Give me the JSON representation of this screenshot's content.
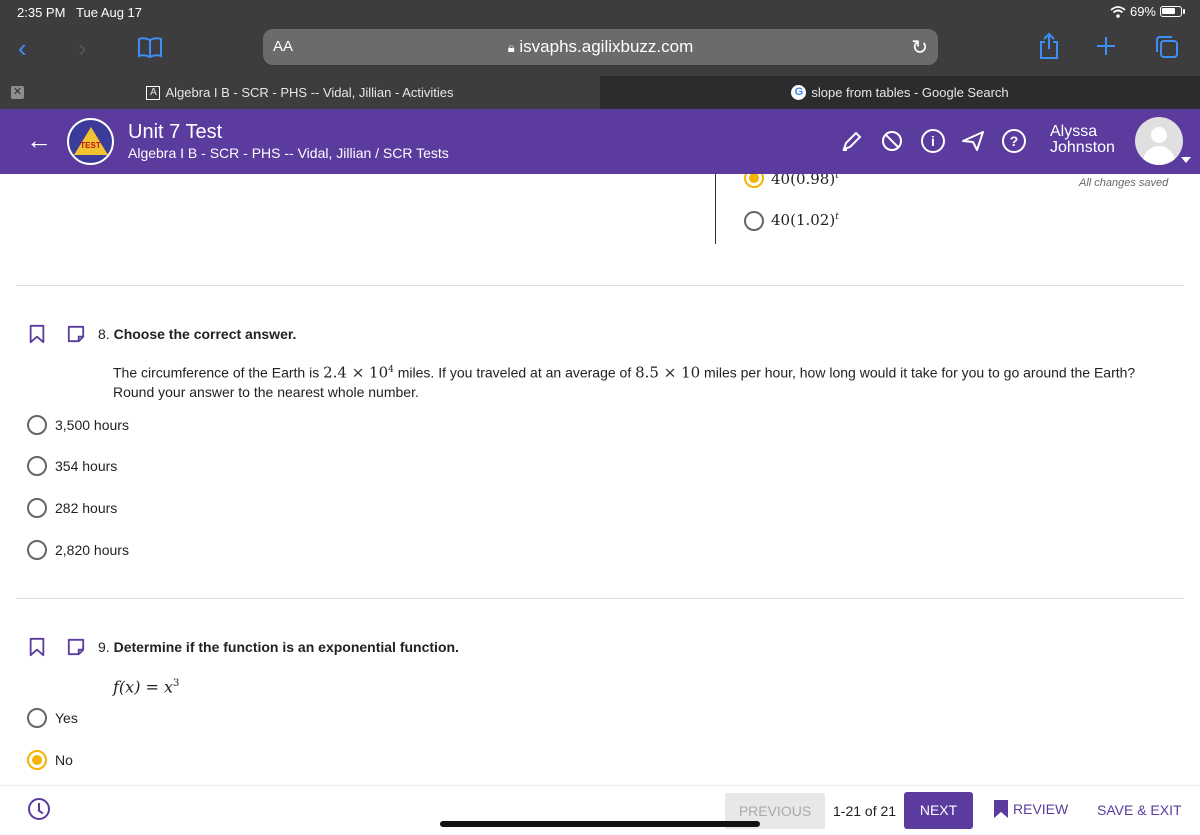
{
  "status": {
    "time": "2:35 PM",
    "date": "Tue Aug 17",
    "battery": "69%"
  },
  "browser": {
    "text_size_label": "AA",
    "url": "isvaphs.agilixbuzz.com"
  },
  "tabs": [
    {
      "favicon": "A",
      "label": "Algebra I B - SCR - PHS -- Vidal, Jillian - Activities"
    },
    {
      "favicon": "G",
      "label": "slope from tables - Google Search"
    }
  ],
  "header": {
    "logo_text": "TEST",
    "title": "Unit 7 Test",
    "subtitle": "Algebra I B - SCR - PHS -- Vidal, Jillian / SCR Tests",
    "user_first": "Alyssa",
    "user_last": "Johnston",
    "icons": [
      "highlighter-icon",
      "block-icon",
      "info-icon",
      "send-icon",
      "help-icon"
    ]
  },
  "prev_question": {
    "options": [
      {
        "base": "40(0.98)",
        "exp": "t",
        "selected": true
      },
      {
        "base": "40(1.02)",
        "exp": "t",
        "selected": false
      }
    ],
    "saved_status": "All changes saved"
  },
  "question8": {
    "number": "8.",
    "prompt": "Choose the correct answer.",
    "text_parts": {
      "p1": "The circumference of the Earth is ",
      "m1": "2.4 × 10",
      "m1_exp": "4",
      "p2": " miles. If you traveled at an average of ",
      "m2": "8.5 × 10",
      "p3": " miles per hour, how long would it take for you to go around the Earth? Round your answer to the nearest whole number."
    },
    "options": [
      {
        "label": "3,500 hours",
        "selected": false
      },
      {
        "label": "354 hours",
        "selected": false
      },
      {
        "label": "282 hours",
        "selected": false
      },
      {
        "label": "2,820 hours",
        "selected": false
      }
    ]
  },
  "question9": {
    "number": "9.",
    "prompt": "Determine if the function is an exponential function.",
    "formula": "f(x) = x",
    "formula_exp": "3",
    "options": [
      {
        "label": "Yes",
        "selected": false
      },
      {
        "label": "No",
        "selected": true
      }
    ]
  },
  "footer": {
    "previous": "PREVIOUS",
    "page_count": "1-21 of 21",
    "next": "NEXT",
    "review": "REVIEW",
    "save_exit": "SAVE & EXIT"
  },
  "colors": {
    "brand": "#5b3b9e",
    "selected": "#f4b400",
    "link": "#3d8ef5"
  }
}
